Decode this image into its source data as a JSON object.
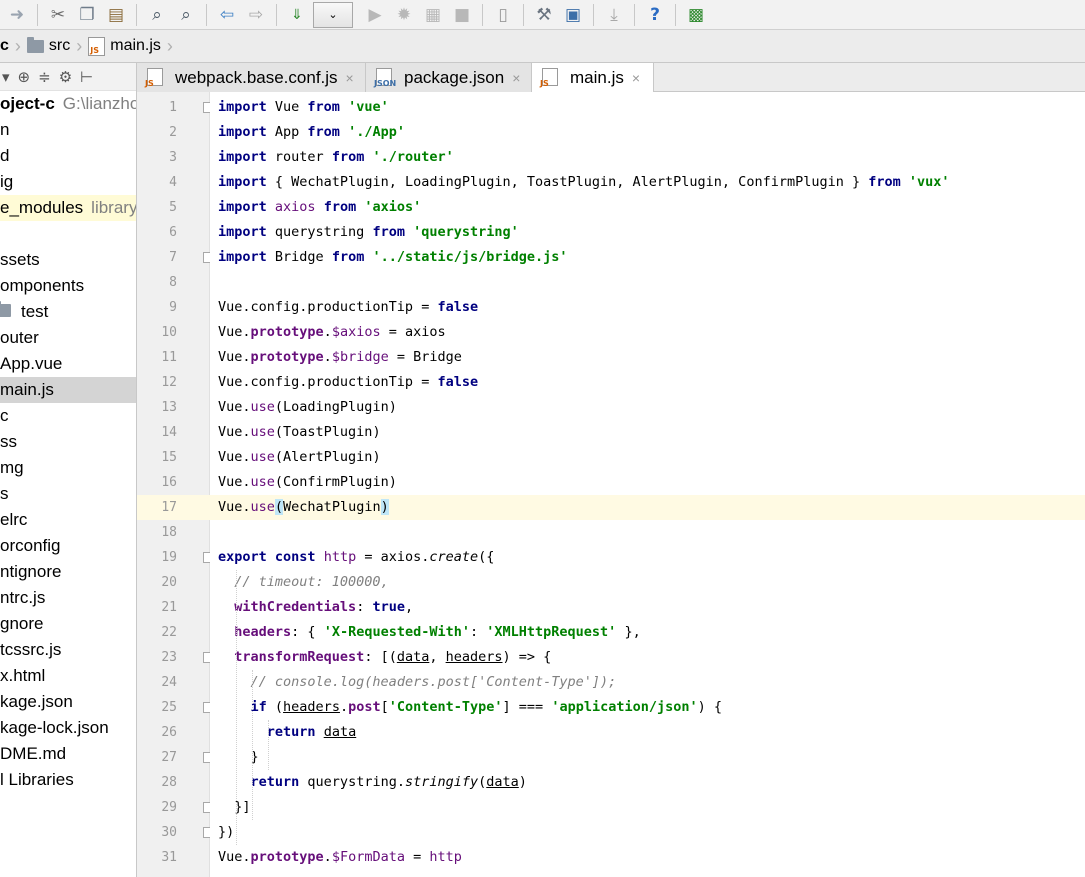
{
  "toolbar": {
    "icons": [
      "redo-icon",
      "cut-icon",
      "copy-icon",
      "paste-icon",
      "find-icon",
      "replace-icon",
      "back-icon",
      "forward-icon",
      "build-icon",
      "run-configuration-dropdown",
      "run-icon",
      "debug-icon",
      "coverage-icon",
      "stop-icon",
      "vcs-icon",
      "settings-icon",
      "project-structure-icon",
      "update-icon",
      "help-icon",
      "plugin-icon"
    ],
    "combo_value": "⌄"
  },
  "breadcrumb": {
    "items": [
      {
        "label": "c",
        "icon": "none"
      },
      {
        "label": "src",
        "icon": "folder-icon"
      },
      {
        "label": "main.js",
        "icon": "js-file-icon"
      }
    ]
  },
  "sidebar": {
    "toolbar_icons": [
      "collapse-icon",
      "locate-icon",
      "expand-icon",
      "gear-icon",
      "hide-icon"
    ],
    "items": [
      {
        "label": "oject-c",
        "hint": "G:\\lianzho",
        "bold": true
      },
      {
        "label": "n"
      },
      {
        "label": "d"
      },
      {
        "label": "ig"
      },
      {
        "label": "e_modules",
        "hint": "library",
        "excluded": true
      },
      {
        "label": ""
      },
      {
        "label": "ssets"
      },
      {
        "label": "omponents"
      },
      {
        "label": "test",
        "folder": true
      },
      {
        "label": "outer"
      },
      {
        "label": "App.vue"
      },
      {
        "label": "main.js",
        "selected": true
      },
      {
        "label": "c"
      },
      {
        "label": "ss"
      },
      {
        "label": "mg"
      },
      {
        "label": "s"
      },
      {
        "label": "elrc"
      },
      {
        "label": "orconfig"
      },
      {
        "label": "ntignore"
      },
      {
        "label": "ntrc.js"
      },
      {
        "label": "gnore"
      },
      {
        "label": "tcssrc.js"
      },
      {
        "label": "x.html"
      },
      {
        "label": "kage.json"
      },
      {
        "label": "kage-lock.json"
      },
      {
        "label": "DME.md"
      },
      {
        "label": "l Libraries"
      }
    ]
  },
  "tabs": [
    {
      "label": "webpack.base.conf.js",
      "close": "×",
      "type": "JS",
      "active": false
    },
    {
      "label": "package.json",
      "close": "×",
      "type": "JSON",
      "active": false
    },
    {
      "label": "main.js",
      "close": "×",
      "type": "JS",
      "active": true
    }
  ],
  "editor": {
    "current_line": 17,
    "lines": [
      {
        "n": "1",
        "fold": true,
        "t": [
          [
            "import",
            "kw"
          ],
          [
            " Vue ",
            ""
          ],
          [
            "from",
            "kw"
          ],
          [
            " ",
            ""
          ],
          [
            "'vue'",
            "str"
          ]
        ]
      },
      {
        "n": "2",
        "t": [
          [
            "import",
            "kw"
          ],
          [
            " App ",
            ""
          ],
          [
            "from",
            "kw"
          ],
          [
            " ",
            ""
          ],
          [
            "'./App'",
            "str"
          ]
        ]
      },
      {
        "n": "3",
        "t": [
          [
            "import",
            "kw"
          ],
          [
            " router ",
            ""
          ],
          [
            "from",
            "kw"
          ],
          [
            " ",
            ""
          ],
          [
            "'./router'",
            "str"
          ]
        ]
      },
      {
        "n": "4",
        "t": [
          [
            "import",
            "kw"
          ],
          [
            " { WechatPlugin, LoadingPlugin, ToastPlugin, AlertPlugin, ConfirmPlugin } ",
            ""
          ],
          [
            "from",
            "kw"
          ],
          [
            " ",
            ""
          ],
          [
            "'vux'",
            "str"
          ]
        ]
      },
      {
        "n": "5",
        "t": [
          [
            "import",
            "kw"
          ],
          [
            " ",
            ""
          ],
          [
            "axios",
            "fld"
          ],
          [
            " ",
            ""
          ],
          [
            "from",
            "kw"
          ],
          [
            " ",
            ""
          ],
          [
            "'axios'",
            "str"
          ]
        ]
      },
      {
        "n": "6",
        "t": [
          [
            "import",
            "kw"
          ],
          [
            " querystring ",
            ""
          ],
          [
            "from",
            "kw"
          ],
          [
            " ",
            ""
          ],
          [
            "'querystring'",
            "str"
          ]
        ]
      },
      {
        "n": "7",
        "fold": true,
        "t": [
          [
            "import",
            "kw"
          ],
          [
            " Bridge ",
            ""
          ],
          [
            "from",
            "kw"
          ],
          [
            " ",
            ""
          ],
          [
            "'../static/js/bridge.js'",
            "str"
          ]
        ]
      },
      {
        "n": "8",
        "t": []
      },
      {
        "n": "9",
        "t": [
          [
            "Vue.config.productionTip = ",
            ""
          ],
          [
            "false",
            "kw"
          ]
        ]
      },
      {
        "n": "10",
        "t": [
          [
            "Vue.",
            ""
          ],
          [
            "prototype",
            "prop"
          ],
          [
            ".",
            ""
          ],
          [
            "$axios",
            "fld"
          ],
          [
            " = axios",
            ""
          ]
        ]
      },
      {
        "n": "11",
        "t": [
          [
            "Vue.",
            ""
          ],
          [
            "prototype",
            "prop"
          ],
          [
            ".",
            ""
          ],
          [
            "$bridge",
            "fld"
          ],
          [
            " = Bridge",
            ""
          ]
        ]
      },
      {
        "n": "12",
        "t": [
          [
            "Vue.config.productionTip = ",
            ""
          ],
          [
            "false",
            "kw"
          ]
        ]
      },
      {
        "n": "13",
        "t": [
          [
            "Vue.",
            ""
          ],
          [
            "use",
            "fld"
          ],
          [
            "(LoadingPlugin)",
            ""
          ]
        ]
      },
      {
        "n": "14",
        "t": [
          [
            "Vue.",
            ""
          ],
          [
            "use",
            "fld"
          ],
          [
            "(ToastPlugin)",
            ""
          ]
        ]
      },
      {
        "n": "15",
        "t": [
          [
            "Vue.",
            ""
          ],
          [
            "use",
            "fld"
          ],
          [
            "(AlertPlugin)",
            ""
          ]
        ]
      },
      {
        "n": "16",
        "t": [
          [
            "Vue.",
            ""
          ],
          [
            "use",
            "fld"
          ],
          [
            "(ConfirmPlugin)",
            ""
          ]
        ]
      },
      {
        "n": "17",
        "t": [
          [
            "Vue.",
            ""
          ],
          [
            "use",
            "fld"
          ],
          [
            "(",
            "hl"
          ],
          [
            "WechatPlugin",
            ""
          ],
          [
            ")",
            "hl"
          ]
        ]
      },
      {
        "n": "18",
        "t": []
      },
      {
        "n": "19",
        "fold": true,
        "t": [
          [
            "export",
            "kw"
          ],
          [
            " ",
            ""
          ],
          [
            "const",
            "kw"
          ],
          [
            " ",
            ""
          ],
          [
            "http",
            "fld"
          ],
          [
            " = axios.",
            ""
          ],
          [
            "create",
            "fnc"
          ],
          [
            "({",
            ""
          ]
        ]
      },
      {
        "n": "20",
        "t": [
          [
            "  ",
            ""
          ],
          [
            "// timeout: 100000,",
            "cmt"
          ]
        ]
      },
      {
        "n": "21",
        "t": [
          [
            "  ",
            ""
          ],
          [
            "withCredentials",
            "prop"
          ],
          [
            ": ",
            ""
          ],
          [
            "true",
            "kw"
          ],
          [
            ",",
            ""
          ]
        ]
      },
      {
        "n": "22",
        "t": [
          [
            "  ",
            ""
          ],
          [
            "headers",
            "prop"
          ],
          [
            ": { ",
            ""
          ],
          [
            "'X-Requested-With'",
            "str"
          ],
          [
            ": ",
            ""
          ],
          [
            "'XMLHttpRequest'",
            "str"
          ],
          [
            " },",
            ""
          ]
        ]
      },
      {
        "n": "23",
        "fold": true,
        "t": [
          [
            "  ",
            ""
          ],
          [
            "transformRequest",
            "prop"
          ],
          [
            ": [(",
            ""
          ],
          [
            "data",
            "ul"
          ],
          [
            ", ",
            ""
          ],
          [
            "headers",
            "ul"
          ],
          [
            ") => {",
            ""
          ]
        ]
      },
      {
        "n": "24",
        "t": [
          [
            "    ",
            ""
          ],
          [
            "// console.log(headers.post['Content-Type']);",
            "cmt"
          ]
        ]
      },
      {
        "n": "25",
        "fold": true,
        "t": [
          [
            "    ",
            ""
          ],
          [
            "if",
            "kw"
          ],
          [
            " (",
            ""
          ],
          [
            "headers",
            "ul"
          ],
          [
            ".",
            ""
          ],
          [
            "post",
            "prop"
          ],
          [
            "[",
            ""
          ],
          [
            "'Content-Type'",
            "str"
          ],
          [
            "] === ",
            ""
          ],
          [
            "'application/json'",
            "str"
          ],
          [
            ") {",
            ""
          ]
        ]
      },
      {
        "n": "26",
        "t": [
          [
            "      ",
            ""
          ],
          [
            "return",
            "kw"
          ],
          [
            " ",
            ""
          ],
          [
            "data",
            "ul"
          ]
        ]
      },
      {
        "n": "27",
        "fold": true,
        "t": [
          [
            "    }",
            ""
          ]
        ]
      },
      {
        "n": "28",
        "t": [
          [
            "    ",
            ""
          ],
          [
            "return",
            "kw"
          ],
          [
            " querystring.",
            ""
          ],
          [
            "stringify",
            "fnc"
          ],
          [
            "(",
            ""
          ],
          [
            "data",
            "ul"
          ],
          [
            ")",
            ""
          ]
        ]
      },
      {
        "n": "29",
        "fold": true,
        "t": [
          [
            "  }]",
            ""
          ]
        ]
      },
      {
        "n": "30",
        "fold": true,
        "t": [
          [
            "})",
            ""
          ]
        ]
      },
      {
        "n": "31",
        "t": [
          [
            "Vue.",
            ""
          ],
          [
            "prototype",
            "prop"
          ],
          [
            ".",
            ""
          ],
          [
            "$FormData",
            "fld"
          ],
          [
            " = ",
            ""
          ],
          [
            "http",
            "fld"
          ]
        ]
      }
    ]
  }
}
